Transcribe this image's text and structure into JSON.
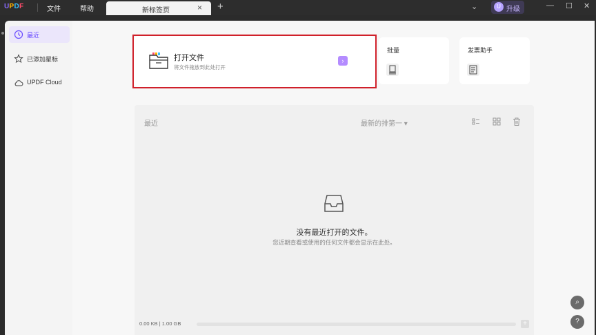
{
  "app": {
    "logo": "UPDF"
  },
  "menu": {
    "file": "文件",
    "help": "帮助"
  },
  "tab": {
    "label": "新标签页",
    "close": "×",
    "new": "+"
  },
  "account": {
    "avatar_letter": "U",
    "upgrade_label": "升级"
  },
  "window": {
    "minimize": "—",
    "maximize": "☐",
    "close": "✕",
    "dropdown": "⌄"
  },
  "sidebar": {
    "items": [
      {
        "label": "最近",
        "icon": "clock-icon",
        "active": true
      },
      {
        "label": "已添加星标",
        "icon": "star-icon",
        "active": false
      },
      {
        "label": "UPDF Cloud",
        "icon": "cloud-icon",
        "active": false
      }
    ]
  },
  "open_file": {
    "title": "打开文件",
    "subtitle": "将文件拖放到此处打开",
    "arrow": "›"
  },
  "cards": {
    "batch": "批量",
    "invoice": "发票助手"
  },
  "recent": {
    "title": "最近",
    "sort_label": "最新的排第一 ▾",
    "empty_title": "没有最近打开的文件。",
    "empty_subtitle": "您近期查看或使用的任何文件都会显示在此处。"
  },
  "storage": {
    "text": "0.00 KB | 1.00 GB",
    "used_fraction": 0.0
  },
  "fab": {
    "search": "⌕",
    "help": "?"
  },
  "colors": {
    "accent": "#8a6cff",
    "highlight": "#d0202a"
  }
}
